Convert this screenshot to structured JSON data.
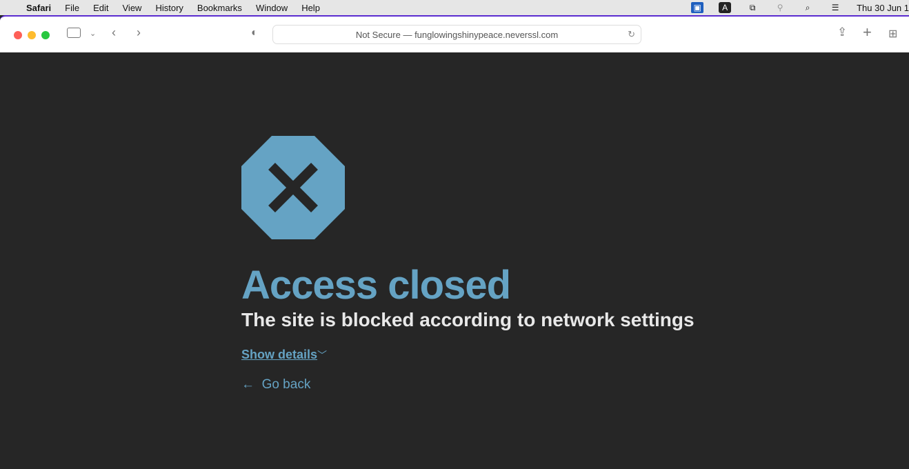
{
  "menubar": {
    "app": "Safari",
    "items": [
      "File",
      "Edit",
      "View",
      "History",
      "Bookmarks",
      "Window",
      "Help"
    ],
    "clock": "Thu 30 Jun 1"
  },
  "browser": {
    "url_text": "Not Secure — funglowingshinypeace.neverssl.com"
  },
  "page": {
    "title": "Access closed",
    "subtitle": "The site is blocked according to network settings",
    "details_link": "Show details",
    "back_link": "Go back",
    "accent_color": "#65a3c4",
    "background_color": "#262626"
  }
}
